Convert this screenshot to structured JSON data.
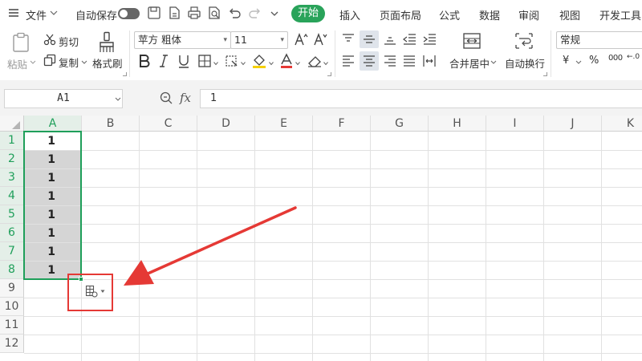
{
  "menubar": {
    "file": "文件",
    "autosave": "自动保存",
    "tabs": [
      "开始",
      "插入",
      "页面布局",
      "公式",
      "数据",
      "审阅",
      "视图",
      "开发工具"
    ]
  },
  "ribbon": {
    "paste": "粘贴",
    "cut": "剪切",
    "copy": "复制",
    "format_painter": "格式刷",
    "font_name": "苹方 粗体",
    "font_size": "11",
    "merge_center": "合并居中",
    "wrap_text": "自动换行",
    "number_format": "常规",
    "currency_symbol": "¥",
    "percent_symbol": "%",
    "thousands_symbol": "000",
    "decimal_symbol": "←.0"
  },
  "formula_bar": {
    "name_box": "A1",
    "fx": "fx",
    "value": "1"
  },
  "grid": {
    "columns": [
      "A",
      "B",
      "C",
      "D",
      "E",
      "F",
      "G",
      "H",
      "I",
      "J",
      "K"
    ],
    "rows": [
      "1",
      "2",
      "3",
      "4",
      "5",
      "6",
      "7",
      "8",
      "9",
      "10",
      "11",
      "12"
    ],
    "column_a_values": [
      "1",
      "1",
      "1",
      "1",
      "1",
      "1",
      "1",
      "1"
    ]
  },
  "colors": {
    "accent_green": "#29a35a",
    "selection_green": "#1f9f5a",
    "annotation_red": "#e53935"
  }
}
